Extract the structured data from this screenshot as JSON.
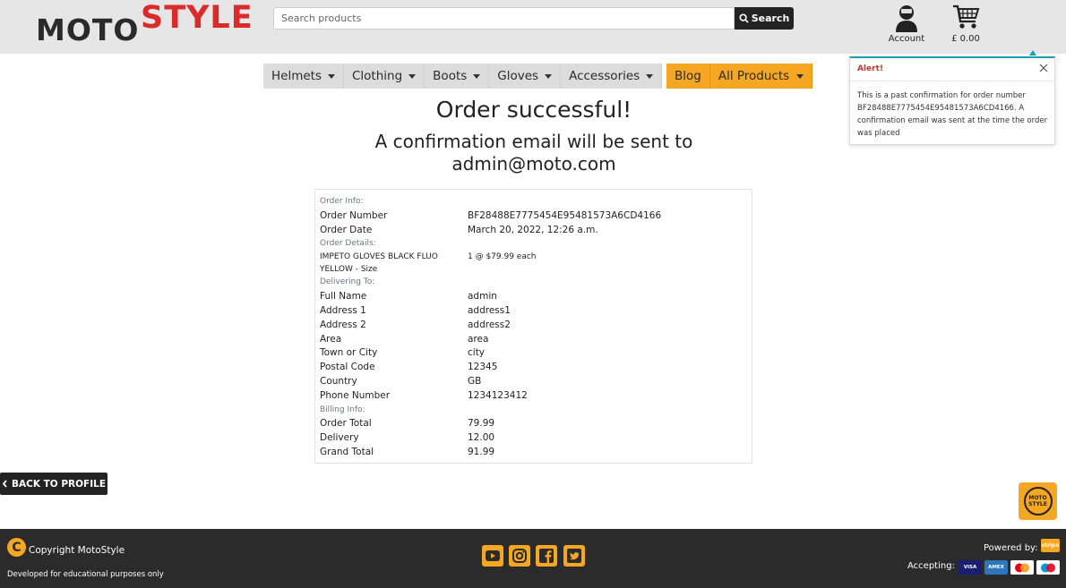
{
  "header": {
    "logo": {
      "part1": "MOTO",
      "part2": "STYLE"
    },
    "search": {
      "placeholder": "Search products",
      "button_label": "Search"
    },
    "account_label": "Account",
    "cart_total": "£ 0.00"
  },
  "nav": {
    "left_items": [
      {
        "label": "Helmets"
      },
      {
        "label": "Clothing"
      },
      {
        "label": "Boots"
      },
      {
        "label": "Gloves"
      },
      {
        "label": "Accessories"
      }
    ],
    "right_items": [
      {
        "label": "Blog"
      },
      {
        "label": "All Products"
      }
    ]
  },
  "main": {
    "title": "Order successful!",
    "subtitle": "A confirmation email will be sent to admin@moto.com"
  },
  "order": {
    "sections": {
      "order_info": "Order Info:",
      "order_details": "Order Details:",
      "delivering_to": "Delivering To:",
      "billing_info": "Billing Info:"
    },
    "order_number": {
      "label": "Order Number",
      "value": "BF28488E7775454E95481573A6CD4166"
    },
    "order_date": {
      "label": "Order Date",
      "value": "March 20, 2022, 12:26 a.m."
    },
    "item": {
      "name": "IMPETO GLOVES BLACK FLUO YELLOW - Size",
      "qty": "1 @ $79.99 each"
    },
    "delivery": [
      {
        "label": "Full Name",
        "value": "admin"
      },
      {
        "label": "Address 1",
        "value": "address1"
      },
      {
        "label": "Address 2",
        "value": "address2"
      },
      {
        "label": "Area",
        "value": "area"
      },
      {
        "label": "Town or City",
        "value": "city"
      },
      {
        "label": "Postal Code",
        "value": "12345"
      },
      {
        "label": "Country",
        "value": "GB"
      },
      {
        "label": "Phone Number",
        "value": "1234123412"
      }
    ],
    "billing": [
      {
        "label": "Order Total",
        "value": "79.99"
      },
      {
        "label": "Delivery",
        "value": "12.00"
      },
      {
        "label": "Grand Total",
        "value": "91.99"
      }
    ]
  },
  "alert": {
    "title": "Alert!",
    "message": "This is a past confirmation for order number BF28488E7775454E95481573A6CD4166. A confirmation email was sent at the time the order was placed"
  },
  "back_button": "BACK TO PROFILE",
  "badge": {
    "line1": "MOTO",
    "line2": "STYLE"
  },
  "footer": {
    "copyright": "Copyright MotoStyle",
    "developed": "Developed for educational purposes only",
    "powered_by": "Powered by:",
    "stripe": "stripe",
    "accepting": "Accepting:",
    "social_icons": [
      "youtube-icon",
      "instagram-icon",
      "facebook-icon",
      "twitter-icon"
    ],
    "payment_cards": [
      "VISA",
      "AMEX",
      "mastercard",
      "maestro"
    ]
  },
  "colors": {
    "accent_orange": "#f5a623",
    "brand_red": "#d92b2b",
    "dark": "#2b2b2b",
    "alert_blue": "#17a2b8"
  }
}
